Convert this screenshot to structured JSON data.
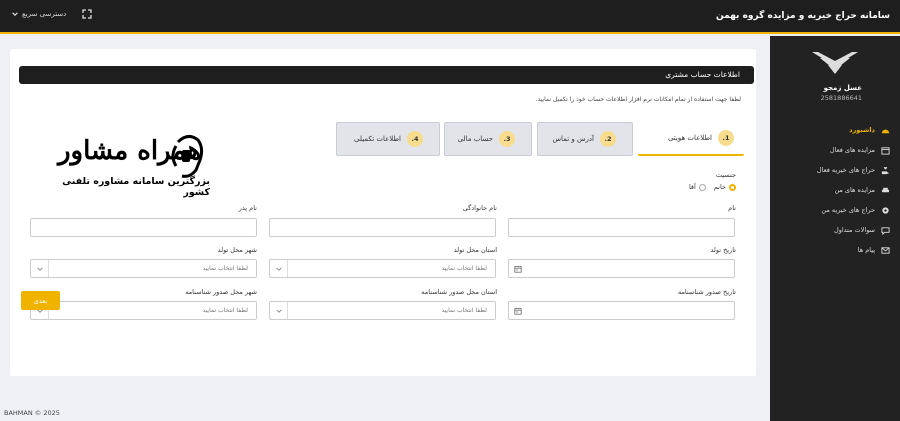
{
  "header": {
    "app_title": "سامانه حراج خیریه و مزایده گروه بهمن",
    "quick_access": "دسترسی سریع"
  },
  "sidebar": {
    "user_name": "عسل زمجو",
    "user_id": "2581886641",
    "items": [
      {
        "label": "داشبورد",
        "icon": "dashboard-icon",
        "active": true
      },
      {
        "label": "مزایده های فعال",
        "icon": "calendar-icon"
      },
      {
        "label": "حراج های خیریه فعال",
        "icon": "hand-heart-icon"
      },
      {
        "label": "مزایده های من",
        "icon": "car-icon"
      },
      {
        "label": "حراج های خیریه من",
        "icon": "gear-icon"
      },
      {
        "label": "سوالات متداول",
        "icon": "chat-icon"
      },
      {
        "label": "پیام ها",
        "icon": "mail-icon"
      }
    ]
  },
  "card": {
    "title": "اطلاعات حساب مشتری",
    "description": "لطفا جهت استفاده از تمام امکانات نرم افزار اطلاعات حساب خود را تکمیل نمایید."
  },
  "steps": [
    {
      "num": "1.",
      "label": "اطلاعات هویتی",
      "active": true
    },
    {
      "num": "2.",
      "label": "آدرس و تماس"
    },
    {
      "num": "3.",
      "label": "حساب مالی"
    },
    {
      "num": "4.",
      "label": "اطلاعات تکمیلی"
    }
  ],
  "form": {
    "gender_label": "جنسیت",
    "gender_options": [
      "آقا",
      "خانم"
    ],
    "gender_selected": "خانم",
    "first_name_label": "نام",
    "last_name_label": "نام خانوادگی",
    "father_name_label": "نام پدر",
    "birth_date_label": "تاریخ تولد",
    "birth_province_label": "استان محل تولد",
    "birth_city_label": "شهر محل تولد",
    "id_issue_date_label": "تاریخ صدور شناسنامه",
    "id_issue_province_label": "استان محل صدور شناسنامه",
    "id_issue_city_label": "شهر محل صدور شناسنامه",
    "select_placeholder": "لطفا انتخاب نمایید",
    "next_label": "بعدی"
  },
  "watermark": {
    "title": "همراه مشاور",
    "subtitle": "بزرگترین سامانه مشاوره تلفنی کشور"
  },
  "footer": {
    "text": "BAHMAN © 2025"
  },
  "colors": {
    "accent": "#f0b400",
    "dark": "#1e1e1e"
  }
}
